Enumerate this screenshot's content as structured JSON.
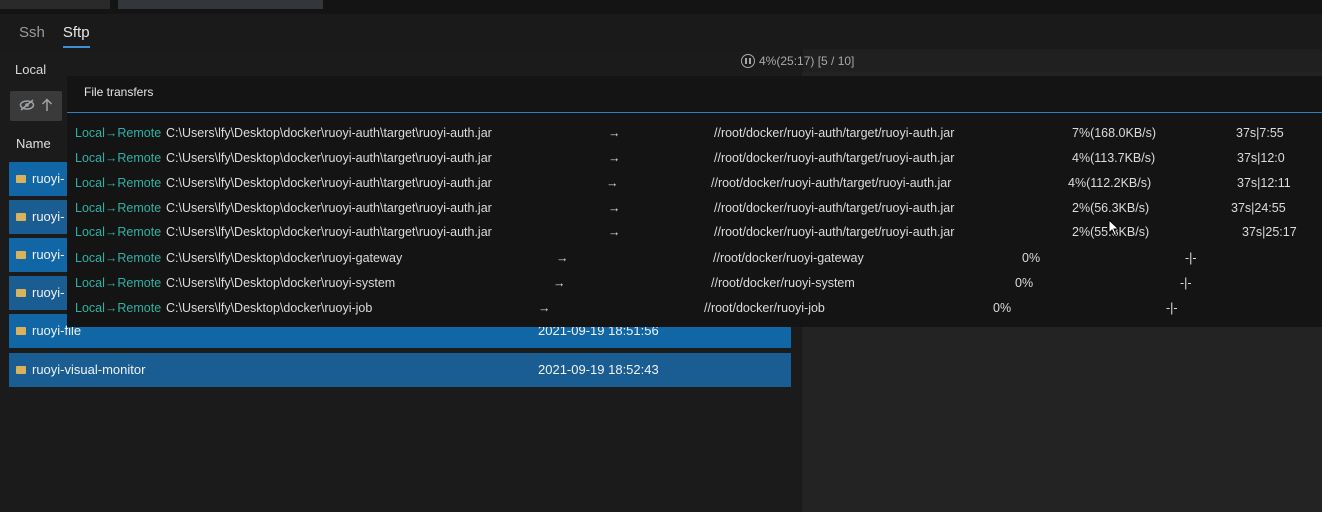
{
  "tabs": {
    "ssh": "Ssh",
    "sftp": "Sftp"
  },
  "local": {
    "label": "Local",
    "column_name": "Name",
    "rows": [
      {
        "name": "ruoyi-",
        "date": ""
      },
      {
        "name": "ruoyi-",
        "date": ""
      },
      {
        "name": "ruoyi-",
        "date": ""
      },
      {
        "name": "ruoyi-",
        "date": ""
      },
      {
        "name": "ruoyi-file",
        "date": "2021-09-19 18:51:56"
      },
      {
        "name": "ruoyi-visual-monitor",
        "date": "2021-09-19 18:52:43"
      }
    ]
  },
  "transfer_status": "4%(25:17)  [5 / 10]",
  "transfers": {
    "title": "File transfers",
    "rows": [
      {
        "dir": "Local→Remote",
        "src": "C:\\Users\\lfy\\Desktop\\docker\\ruoyi-auth\\target\\ruoyi-auth.jar",
        "arrow": "→",
        "dst": "//root/docker/ruoyi-auth/target/ruoyi-auth.jar",
        "pct": "7%(168.0KB/s)",
        "time": "37s|7:55"
      },
      {
        "dir": "Local→Remote",
        "src": "C:\\Users\\lfy\\Desktop\\docker\\ruoyi-auth\\target\\ruoyi-auth.jar",
        "arrow": "→",
        "dst": "//root/docker/ruoyi-auth/target/ruoyi-auth.jar",
        "pct": "4%(113.7KB/s)",
        "time": "37s|12:0"
      },
      {
        "dir": "Local→Remote",
        "src": "C:\\Users\\lfy\\Desktop\\docker\\ruoyi-auth\\target\\ruoyi-auth.jar",
        "arrow": "→",
        "dst": "//root/docker/ruoyi-auth/target/ruoyi-auth.jar",
        "pct": "4%(112.2KB/s)",
        "time": "37s|12:11"
      },
      {
        "dir": "Local→Remote",
        "src": "C:\\Users\\lfy\\Desktop\\docker\\ruoyi-auth\\target\\ruoyi-auth.jar",
        "arrow": "→",
        "dst": "//root/docker/ruoyi-auth/target/ruoyi-auth.jar",
        "pct": "2%(56.3KB/s)",
        "time": "37s|24:55"
      },
      {
        "dir": "Local→Remote",
        "src": "C:\\Users\\lfy\\Desktop\\docker\\ruoyi-auth\\target\\ruoyi-auth.jar",
        "arrow": "→",
        "dst": "//root/docker/ruoyi-auth/target/ruoyi-auth.jar",
        "pct": "2%(55.3KB/s)",
        "time": "37s|25:17"
      },
      {
        "dir": "Local→Remote",
        "src": "C:\\Users\\lfy\\Desktop\\docker\\ruoyi-gateway",
        "arrow": "→",
        "dst": "//root/docker/ruoyi-gateway",
        "pct": "0%",
        "time": "-|-"
      },
      {
        "dir": "Local→Remote",
        "src": "C:\\Users\\lfy\\Desktop\\docker\\ruoyi-system",
        "arrow": "→",
        "dst": "//root/docker/ruoyi-system",
        "pct": "0%",
        "time": "-|-"
      },
      {
        "dir": "Local→Remote",
        "src": "C:\\Users\\lfy\\Desktop\\docker\\ruoyi-job",
        "arrow": "→",
        "dst": "//root/docker/ruoyi-job",
        "pct": "0%",
        "time": "-|-"
      }
    ]
  }
}
